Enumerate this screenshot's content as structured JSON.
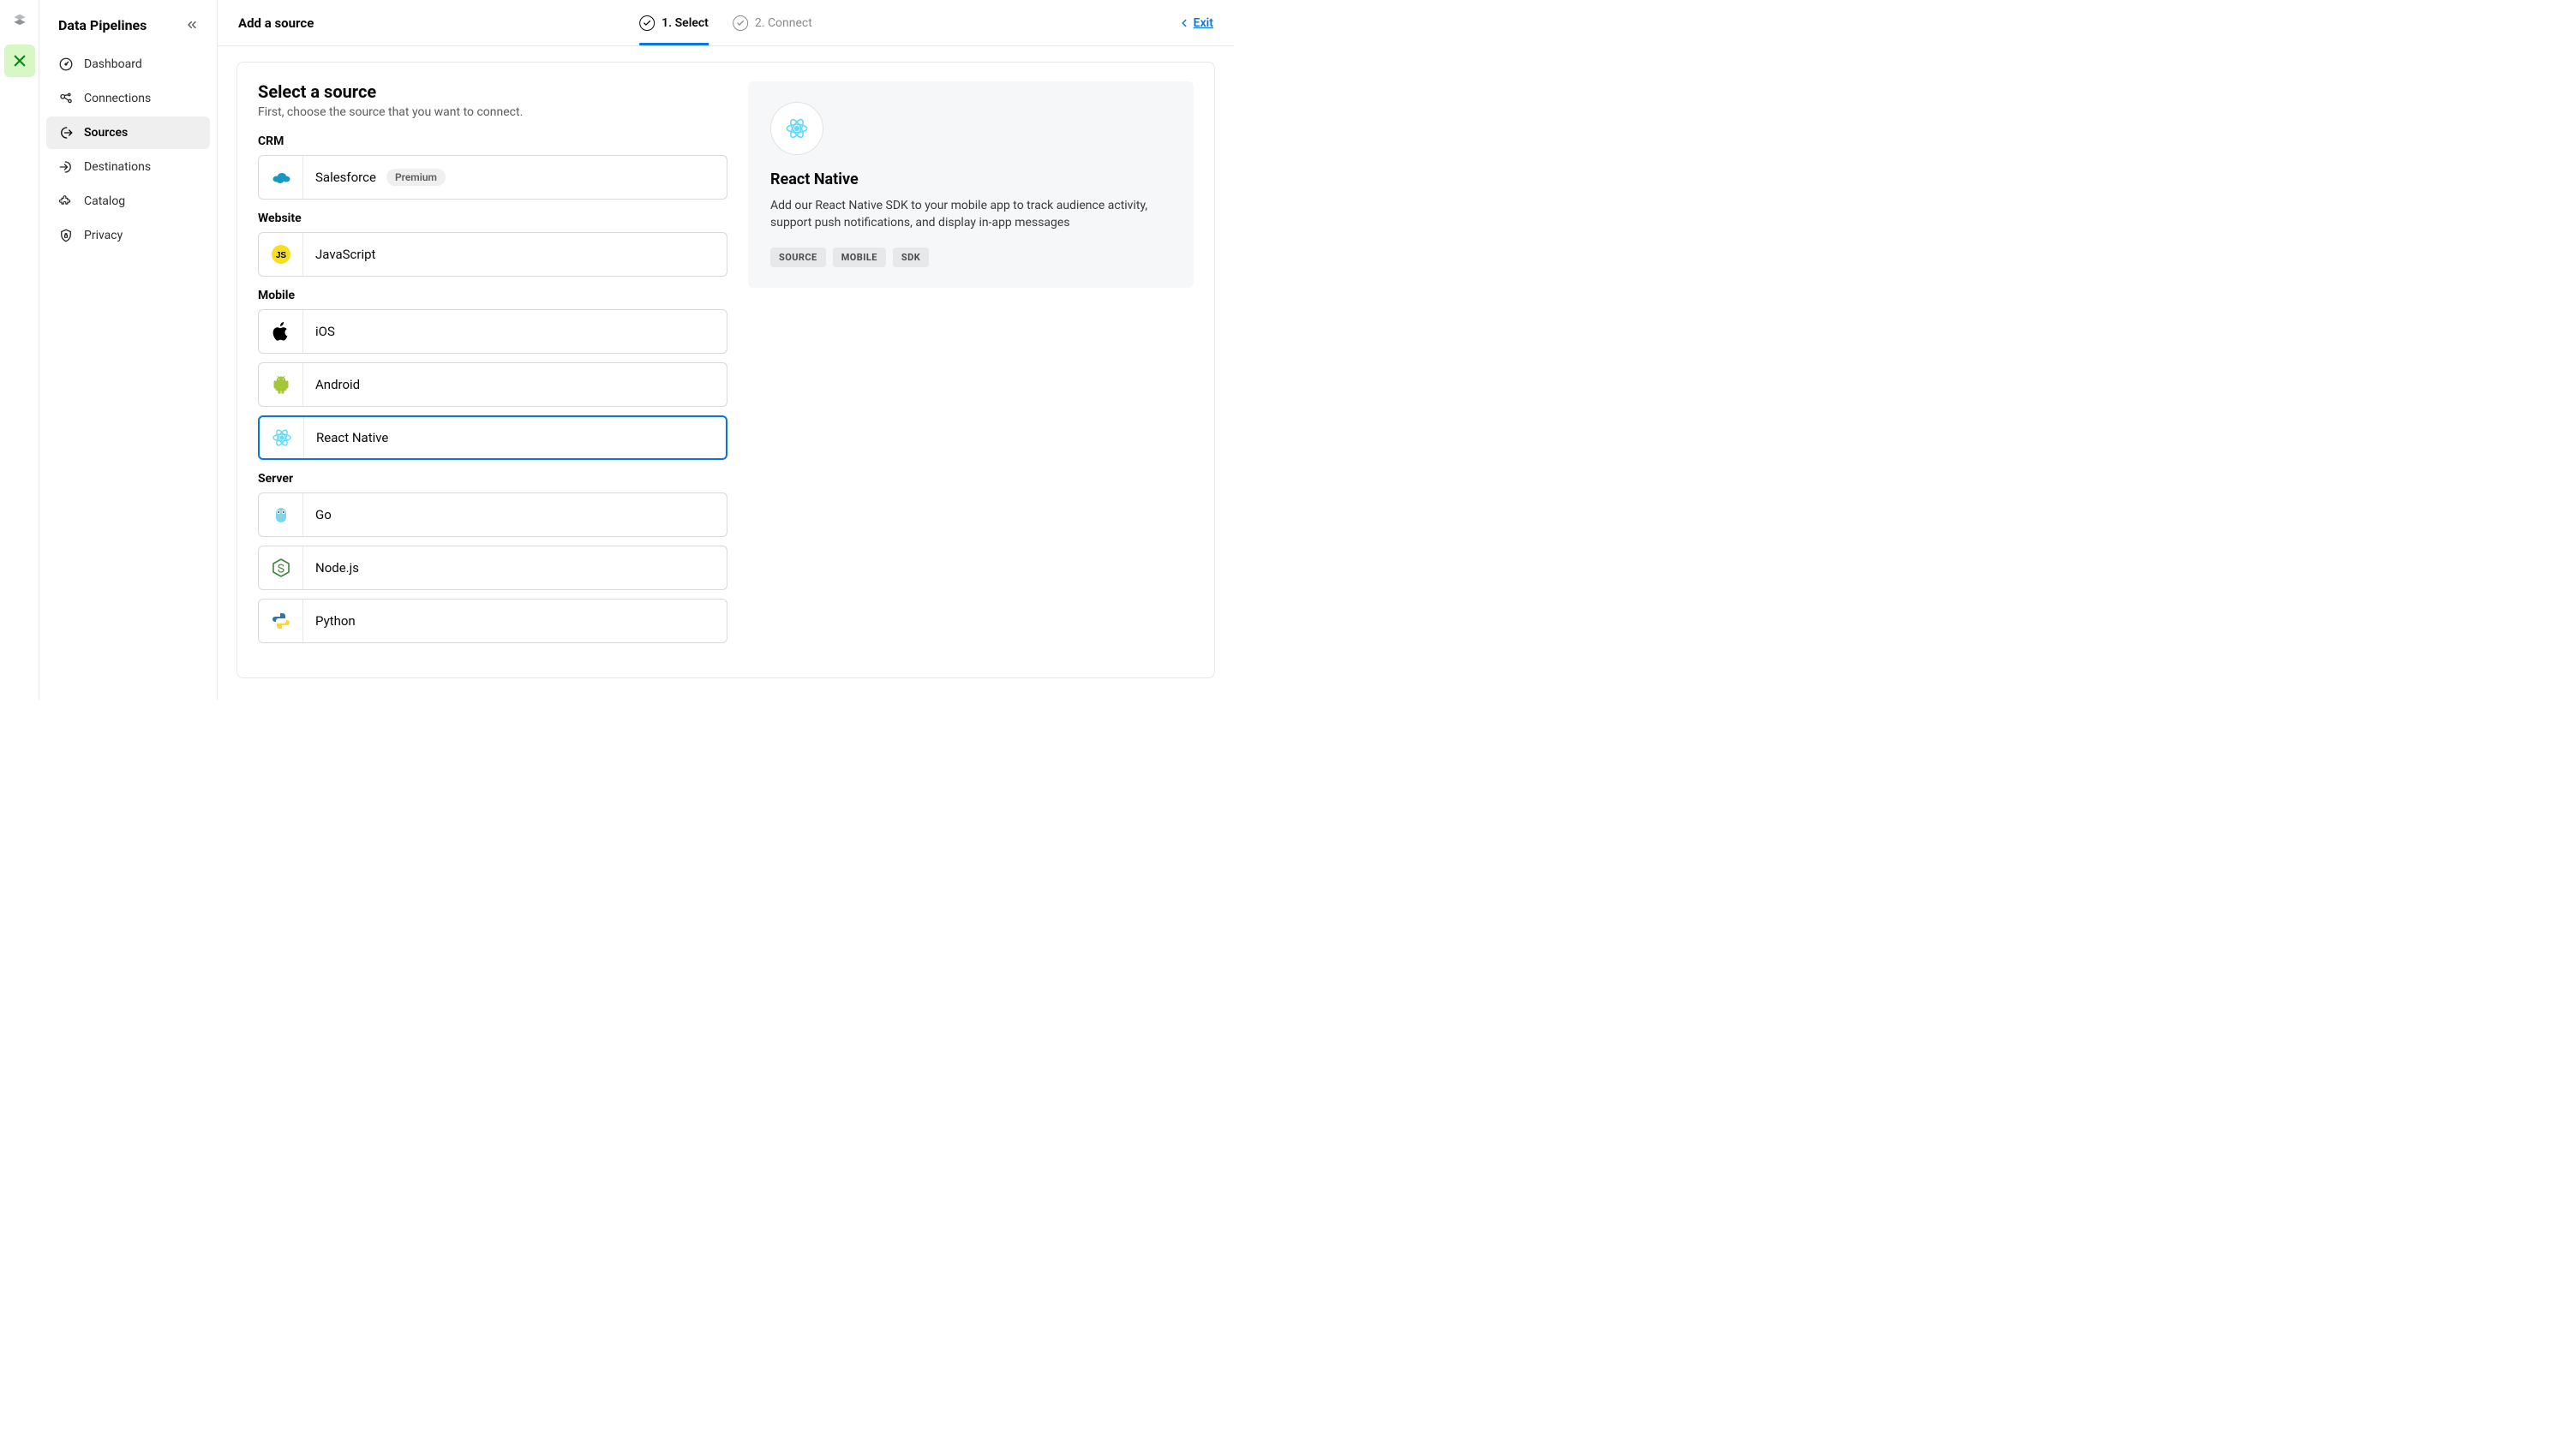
{
  "rail": {
    "logo_name": "segment-logo",
    "app_name": "app-icon"
  },
  "sidebar": {
    "title": "Data Pipelines",
    "items": [
      {
        "id": "dashboard",
        "label": "Dashboard",
        "icon": "gauge-icon",
        "active": false
      },
      {
        "id": "connections",
        "label": "Connections",
        "icon": "connections-icon",
        "active": false
      },
      {
        "id": "sources",
        "label": "Sources",
        "icon": "source-out-icon",
        "active": true
      },
      {
        "id": "destinations",
        "label": "Destinations",
        "icon": "destination-in-icon",
        "active": false
      },
      {
        "id": "catalog",
        "label": "Catalog",
        "icon": "puzzle-icon",
        "active": false
      },
      {
        "id": "privacy",
        "label": "Privacy",
        "icon": "shield-lock-icon",
        "active": false
      }
    ]
  },
  "topbar": {
    "title": "Add a source",
    "steps": [
      {
        "num": "1.",
        "label": "Select",
        "active": true
      },
      {
        "num": "2.",
        "label": "Connect",
        "active": false
      }
    ],
    "exit_label": "Exit"
  },
  "select": {
    "heading": "Select a source",
    "subheading": "First, choose the source that you want to connect.",
    "groups": [
      {
        "label": "CRM",
        "items": [
          {
            "id": "salesforce",
            "label": "Salesforce",
            "icon": "salesforce-icon",
            "badge": "Premium",
            "selected": false
          }
        ]
      },
      {
        "label": "Website",
        "items": [
          {
            "id": "javascript",
            "label": "JavaScript",
            "icon": "js-icon",
            "selected": false
          }
        ]
      },
      {
        "label": "Mobile",
        "items": [
          {
            "id": "ios",
            "label": "iOS",
            "icon": "apple-icon",
            "selected": false
          },
          {
            "id": "android",
            "label": "Android",
            "icon": "android-icon",
            "selected": false
          },
          {
            "id": "react-native",
            "label": "React Native",
            "icon": "react-icon",
            "selected": true
          }
        ]
      },
      {
        "label": "Server",
        "items": [
          {
            "id": "go",
            "label": "Go",
            "icon": "gopher-icon",
            "selected": false
          },
          {
            "id": "nodejs",
            "label": "Node.js",
            "icon": "nodejs-icon",
            "selected": false
          },
          {
            "id": "python",
            "label": "Python",
            "icon": "python-icon",
            "selected": false
          }
        ]
      }
    ]
  },
  "details": {
    "title": "React Native",
    "description": "Add our React Native SDK to your mobile app to track audience activity, support push notifications, and display in-app messages",
    "tags": [
      "SOURCE",
      "MOBILE",
      "SDK"
    ],
    "icon": "react-icon"
  }
}
